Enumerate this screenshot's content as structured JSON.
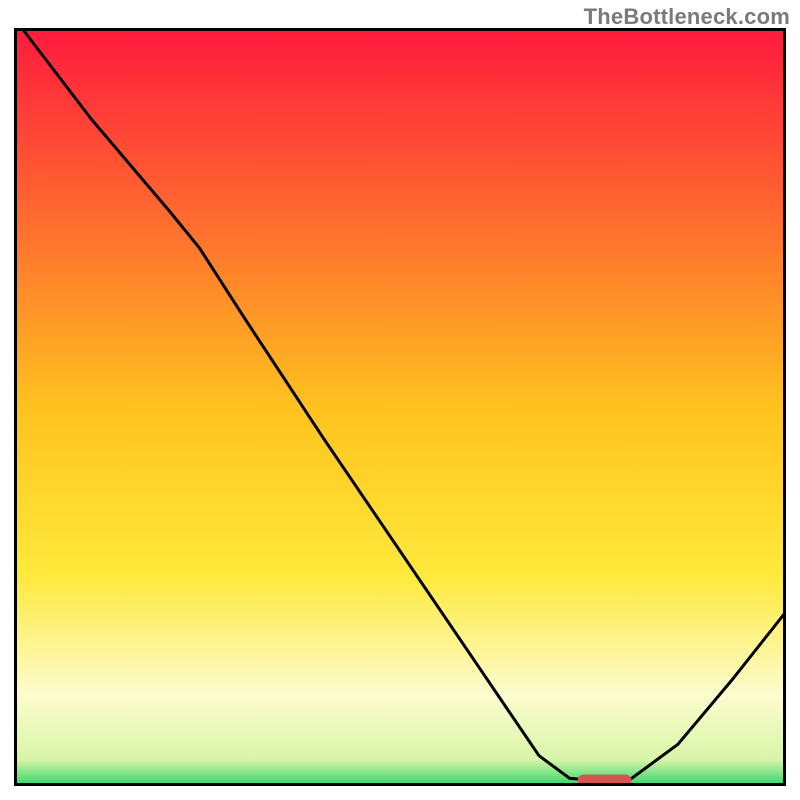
{
  "watermark": "TheBottleneck.com",
  "colors": {
    "frame": "#000000",
    "line": "#000000",
    "marker": "#d9534f",
    "gradient_stops": [
      {
        "offset": 0.0,
        "color": "#ff1a3e"
      },
      {
        "offset": 0.25,
        "color": "#ff6a2f"
      },
      {
        "offset": 0.5,
        "color": "#ffc21f"
      },
      {
        "offset": 0.72,
        "color": "#ffe93a"
      },
      {
        "offset": 0.88,
        "color": "#fdfccf"
      },
      {
        "offset": 0.965,
        "color": "#d8f5a8"
      },
      {
        "offset": 1.0,
        "color": "#2fd56a"
      }
    ]
  },
  "chart_data": {
    "type": "line",
    "title": "",
    "xlabel": "",
    "ylabel": "",
    "xlim": [
      0,
      100
    ],
    "ylim": [
      0,
      100
    ],
    "note": "Axes have no tick labels in the source image; x and y are normalized 0–100. y is the vertical position of the black curve (100 = top border, 0 = bottom border). Values are read from pixel positions.",
    "series": [
      {
        "name": "curve",
        "x": [
          1,
          10,
          20,
          24,
          30,
          40,
          50,
          60,
          68,
          72,
          76,
          80,
          86,
          93,
          100
        ],
        "y": [
          100,
          88,
          76,
          71,
          61.5,
          46,
          31,
          16,
          4,
          1,
          0.7,
          1,
          5.5,
          14,
          23
        ]
      }
    ],
    "marker": {
      "name": "highlight-segment",
      "x_start": 73,
      "x_end": 80,
      "y": 0.7,
      "thickness_pct": 1.6
    }
  }
}
